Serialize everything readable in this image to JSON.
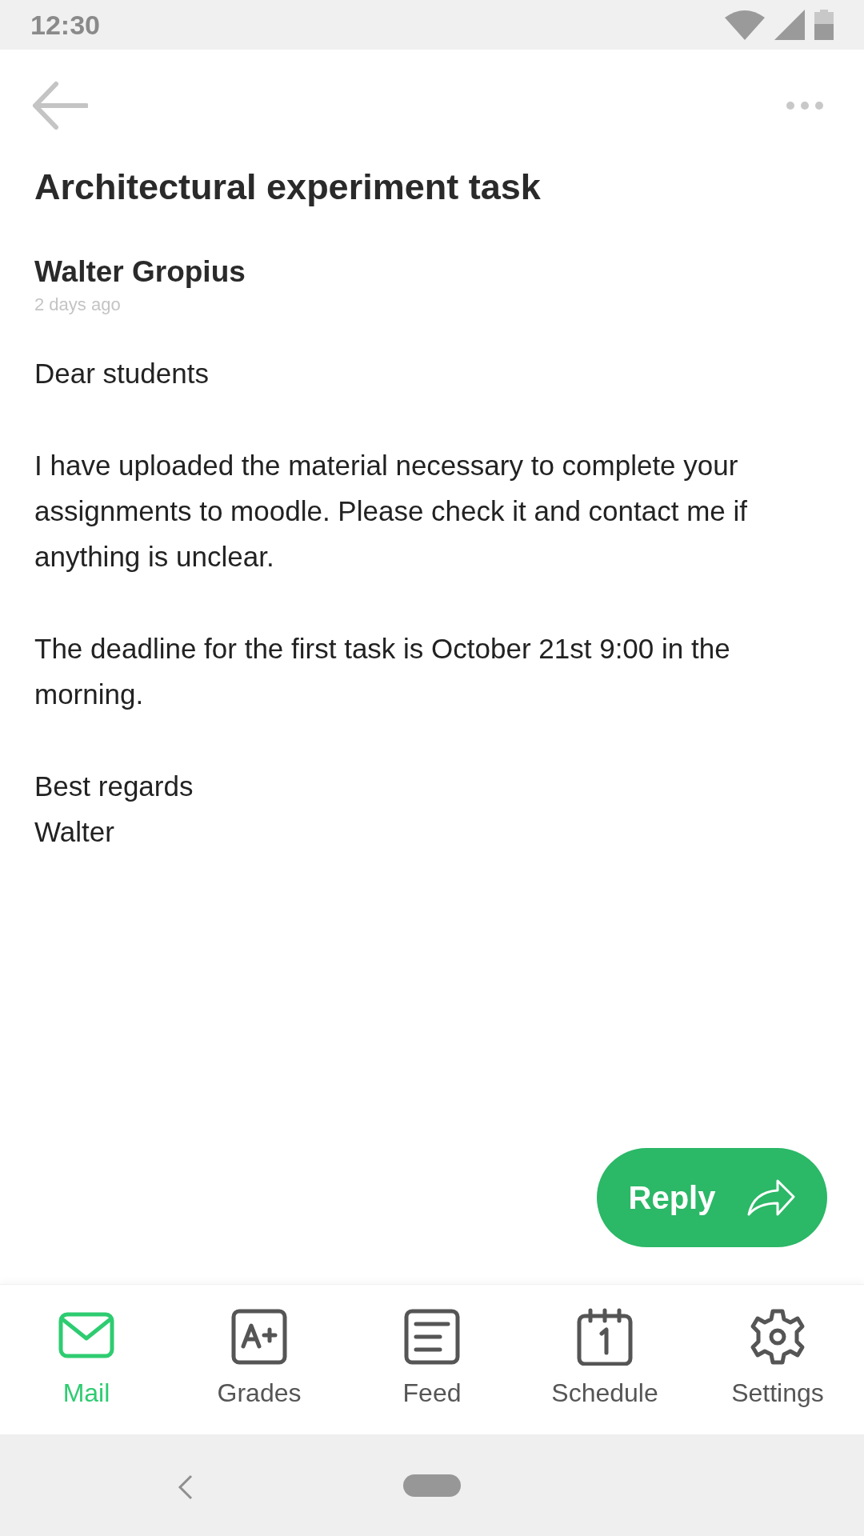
{
  "status_bar": {
    "time": "12:30"
  },
  "message": {
    "title": "Architectural experiment task",
    "sender": "Walter Gropius",
    "time": "2 days ago",
    "paragraphs": [
      "Dear students",
      "I have uploaded the material necessary to complete your assignments to moodle. Please check it and contact me if anything is unclear.",
      "The deadline for the first task is October 21st 9:00 in the morning.",
      "Best regards\nWalter"
    ]
  },
  "reply_button": {
    "label": "Reply"
  },
  "nav": [
    {
      "kind": "mail",
      "label": "Mail",
      "selected": true
    },
    {
      "kind": "grades",
      "label": "Grades",
      "selected": false
    },
    {
      "kind": "feed",
      "label": "Feed",
      "selected": false
    },
    {
      "kind": "schedule",
      "label": "Schedule",
      "selected": false
    },
    {
      "kind": "settings",
      "label": "Settings",
      "selected": false
    }
  ]
}
